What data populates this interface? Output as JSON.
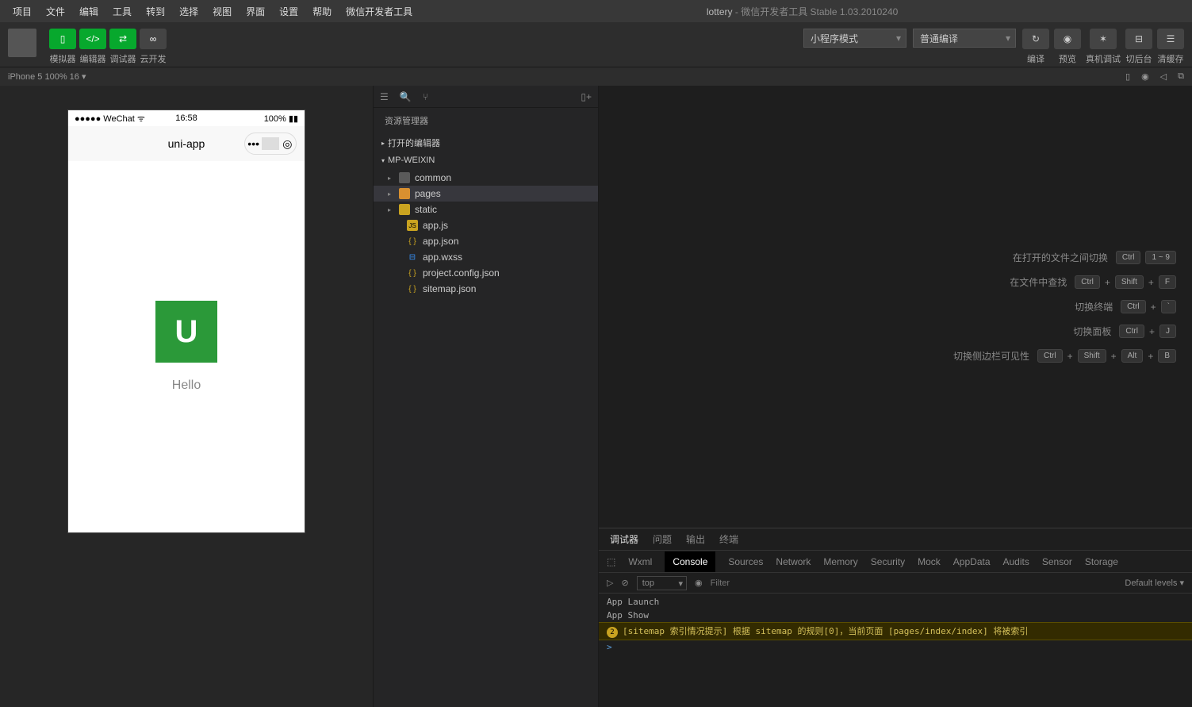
{
  "title": {
    "project": "lottery",
    "suffix": " - 微信开发者工具 Stable 1.03.2010240"
  },
  "menu": [
    "项目",
    "文件",
    "编辑",
    "工具",
    "转到",
    "选择",
    "视图",
    "界面",
    "设置",
    "帮助",
    "微信开发者工具"
  ],
  "toolbar": {
    "labels": [
      "模拟器",
      "编辑器",
      "调试器",
      "云开发"
    ],
    "mode_dropdown": "小程序模式",
    "compile_dropdown": "普通编译",
    "right": [
      "编译",
      "预览",
      "真机调试",
      "切后台",
      "清缓存"
    ]
  },
  "device": "iPhone 5 100% 16",
  "phone": {
    "carrier": "●●●●● WeChat",
    "time": "16:58",
    "battery": "100%",
    "nav_title": "uni-app",
    "hello": "Hello",
    "logo": "U"
  },
  "explorer": {
    "title": "资源管理器",
    "sections": [
      "打开的编辑器",
      "MP-WEIXIN"
    ],
    "tree": [
      {
        "name": "common",
        "type": "folder-gray"
      },
      {
        "name": "pages",
        "type": "folder-orange",
        "selected": true
      },
      {
        "name": "static",
        "type": "folder-yellow"
      },
      {
        "name": "app.js",
        "type": "js"
      },
      {
        "name": "app.json",
        "type": "json"
      },
      {
        "name": "app.wxss",
        "type": "wxss"
      },
      {
        "name": "project.config.json",
        "type": "json"
      },
      {
        "name": "sitemap.json",
        "type": "json"
      }
    ]
  },
  "shortcuts": [
    {
      "label": "在打开的文件之间切换",
      "keys": [
        "Ctrl",
        "1 ~ 9"
      ]
    },
    {
      "label": "在文件中查找",
      "keys": [
        "Ctrl",
        "+",
        "Shift",
        "+",
        "F"
      ]
    },
    {
      "label": "切换终端",
      "keys": [
        "Ctrl",
        "+",
        "`"
      ]
    },
    {
      "label": "切换面板",
      "keys": [
        "Ctrl",
        "+",
        "J"
      ]
    },
    {
      "label": "切换侧边栏可见性",
      "keys": [
        "Ctrl",
        "+",
        "Shift",
        "+",
        "Alt",
        "+",
        "B"
      ]
    }
  ],
  "devtools": {
    "tabs1": [
      "调试器",
      "问题",
      "输出",
      "终端"
    ],
    "tabs2": [
      "Wxml",
      "Console",
      "Sources",
      "Network",
      "Memory",
      "Security",
      "Mock",
      "AppData",
      "Audits",
      "Sensor",
      "Storage"
    ],
    "filter_top": "top",
    "filter_placeholder": "Filter",
    "filter_levels": "Default levels ▾",
    "lines": [
      {
        "text": "App Launch"
      },
      {
        "text": "App Show"
      },
      {
        "badge": "2",
        "text": "[sitemap 索引情况提示] 根据 sitemap 的规则[0]，当前页面 [pages/index/index] 将被索引",
        "warn": true
      }
    ],
    "prompt": ">"
  }
}
